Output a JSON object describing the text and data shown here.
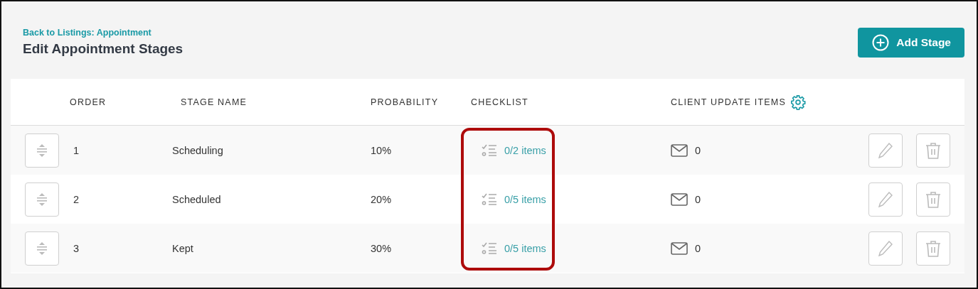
{
  "back_link": "Back to Listings: Appointment",
  "title": "Edit Appointment Stages",
  "add_button": "Add Stage",
  "table": {
    "columns": [
      "ORDER",
      "STAGE NAME",
      "PROBABILITY",
      "CHECKLIST",
      "CLIENT UPDATE ITEMS"
    ],
    "rows": [
      {
        "order": "1",
        "stage": "Scheduling",
        "probability": "10%",
        "checklist": "0/2 items",
        "client_updates": "0"
      },
      {
        "order": "2",
        "stage": "Scheduled",
        "probability": "20%",
        "checklist": "0/5 items",
        "client_updates": "0"
      },
      {
        "order": "3",
        "stage": "Kept",
        "probability": "30%",
        "checklist": "0/5 items",
        "client_updates": "0"
      }
    ]
  }
}
